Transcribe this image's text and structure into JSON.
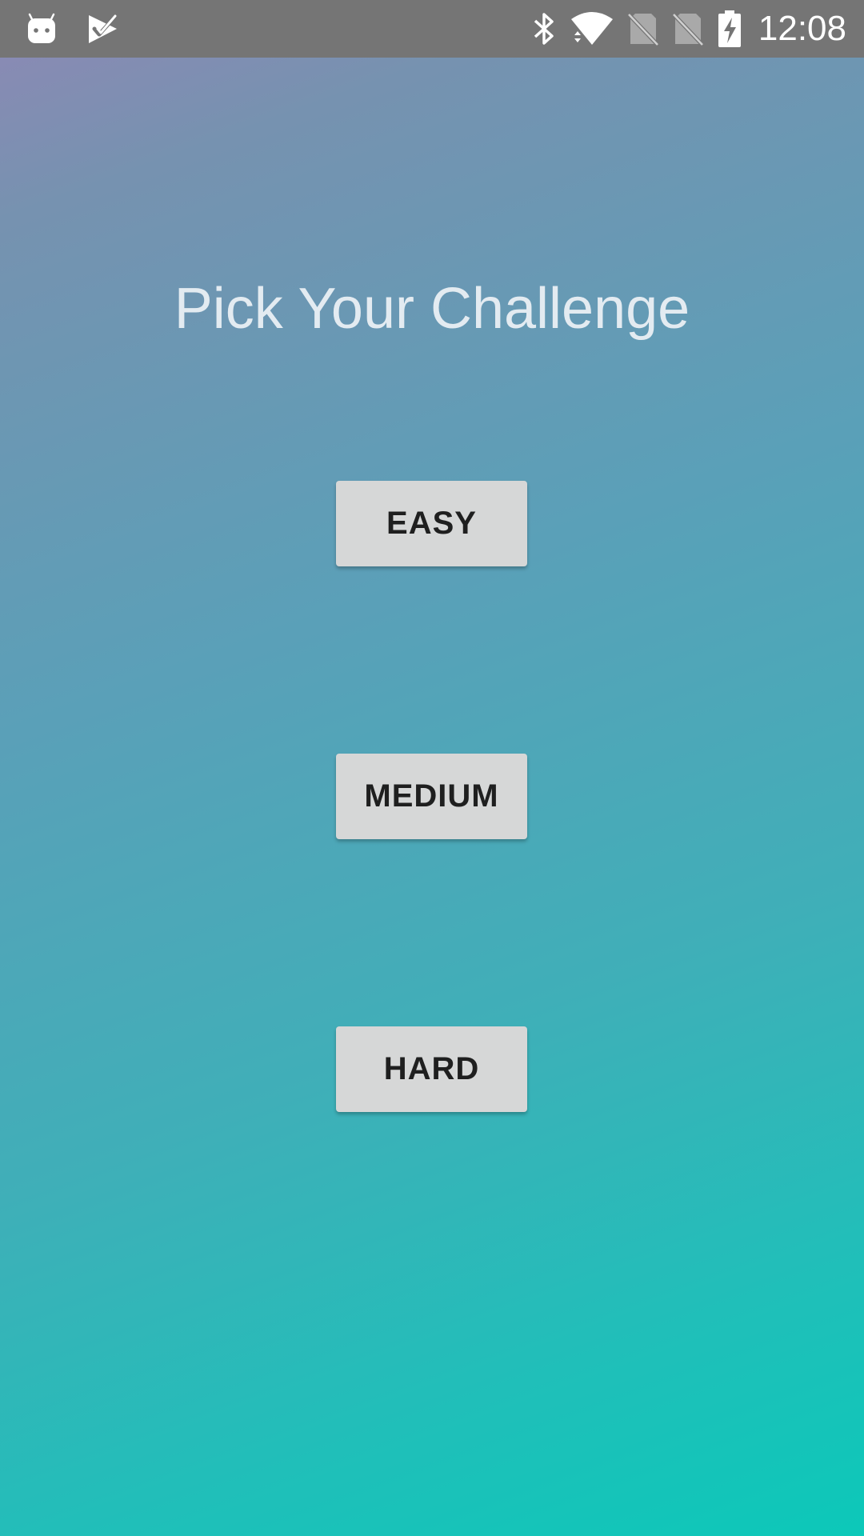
{
  "status_bar": {
    "time": "12:08",
    "left_icons": [
      "android-icon",
      "checklist-icon"
    ],
    "right_icons": [
      "bluetooth-icon",
      "wifi-icon",
      "sim-off-icon",
      "sim-off-icon",
      "battery-charging-icon"
    ],
    "background": "#757575"
  },
  "screen": {
    "title": "Pick Your Challenge",
    "gradient_start": "#8f88b5",
    "gradient_end": "#0cc8b9"
  },
  "buttons": {
    "easy": "EASY",
    "medium": "MEDIUM",
    "hard": "HARD"
  }
}
